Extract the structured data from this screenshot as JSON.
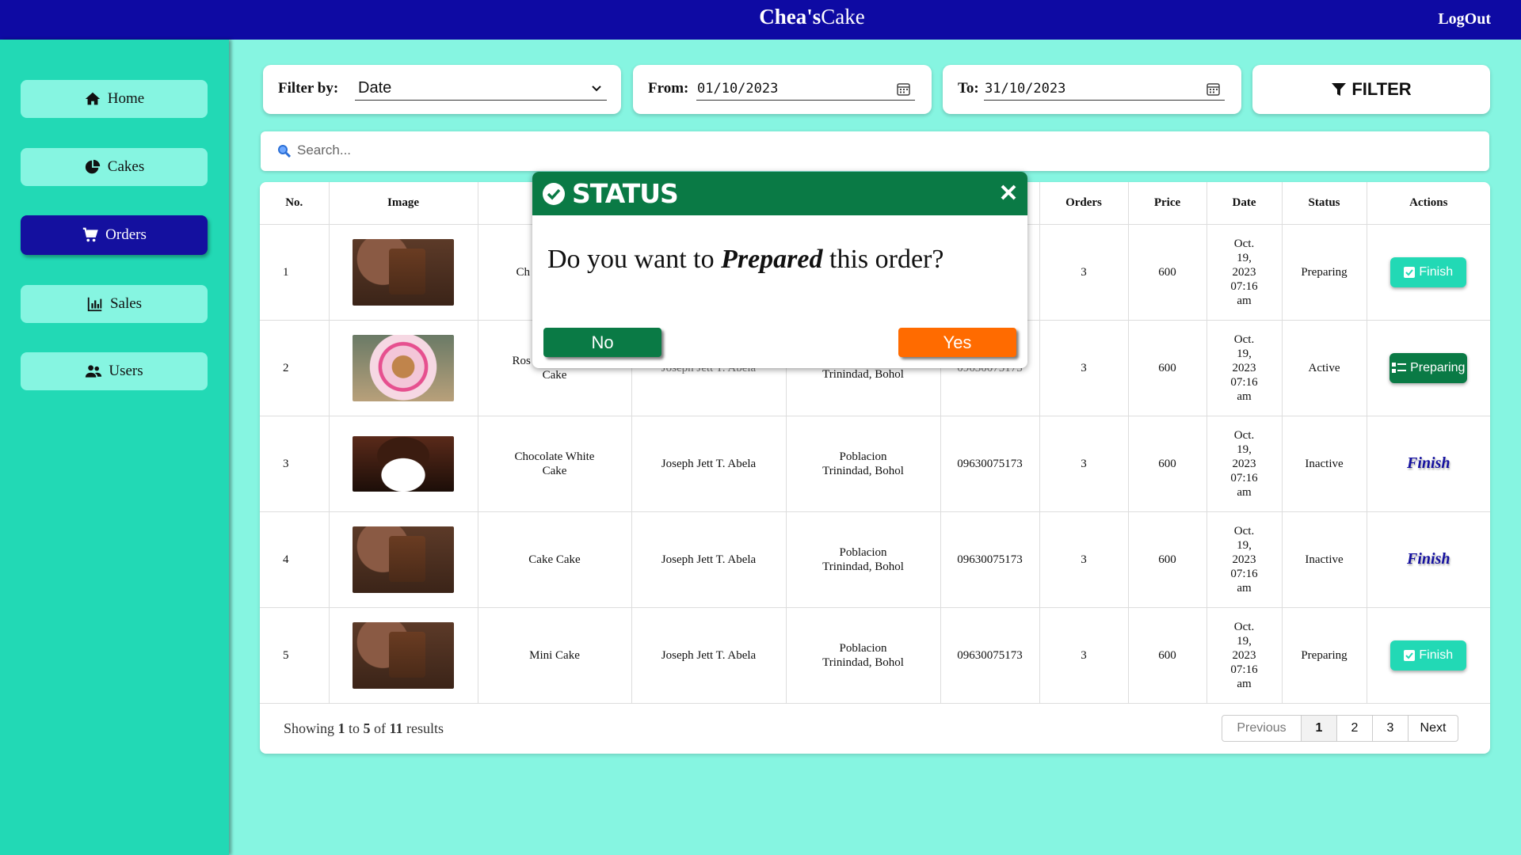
{
  "header": {
    "brand_bold": "Chea's",
    "brand_rest": "Cake",
    "logout": "LogOut"
  },
  "sidebar": {
    "items": [
      {
        "label": "Home",
        "icon": "home-icon"
      },
      {
        "label": "Cakes",
        "icon": "pie-chart-icon"
      },
      {
        "label": "Orders",
        "icon": "cart-icon",
        "active": true
      },
      {
        "label": "Sales",
        "icon": "bar-chart-icon"
      },
      {
        "label": "Users",
        "icon": "users-icon"
      }
    ]
  },
  "filter": {
    "filter_by_label": "Filter by:",
    "filter_by_value": "Date",
    "from_label": "From:",
    "from_value": "01/10/2023",
    "to_label": "To:",
    "to_value": "31/10/2023",
    "button_label": "FILTER"
  },
  "search": {
    "placeholder": "Search..."
  },
  "table": {
    "headers": {
      "no": "No.",
      "image": "Image",
      "orders": "Orders",
      "price": "Price",
      "date": "Date",
      "status": "Status",
      "actions": "Actions"
    },
    "rows": [
      {
        "no": "1",
        "name_partial": "Ch",
        "orders_partial": "3",
        "orders": "3",
        "price": "600",
        "date": [
          "Oct.",
          "19,",
          "2023",
          "07:16",
          "am"
        ],
        "status": "Preparing",
        "action": "Finish"
      },
      {
        "no": "2",
        "name_line1": "Ros",
        "name_line2": "Cake",
        "customer_partial": "Joseph Jett T. Abela",
        "address_partial": "Trinindad, Bohol",
        "phone_partial": "09630075173",
        "orders": "3",
        "price": "600",
        "date": [
          "Oct.",
          "19,",
          "2023",
          "07:16",
          "am"
        ],
        "status": "Active",
        "action": "Preparing"
      },
      {
        "no": "3",
        "name_line1": "Chocolate White",
        "name_line2": "Cake",
        "customer": "Joseph Jett T. Abela",
        "address_line1": "Poblacion",
        "address_line2": "Trinindad, Bohol",
        "phone": "09630075173",
        "orders": "3",
        "price": "600",
        "date": [
          "Oct.",
          "19,",
          "2023",
          "07:16",
          "am"
        ],
        "status": "Inactive",
        "action": "Finish"
      },
      {
        "no": "4",
        "name_line1": "Cake Cake",
        "customer": "Joseph Jett T. Abela",
        "address_line1": "Poblacion",
        "address_line2": "Trinindad, Bohol",
        "phone": "09630075173",
        "orders": "3",
        "price": "600",
        "date": [
          "Oct.",
          "19,",
          "2023",
          "07:16",
          "am"
        ],
        "status": "Inactive",
        "action": "Finish"
      },
      {
        "no": "5",
        "name_line1": "Mini Cake",
        "customer": "Joseph Jett T. Abela",
        "address_line1": "Poblacion",
        "address_line2": "Trinindad, Bohol",
        "phone": "09630075173",
        "orders": "3",
        "price": "600",
        "date": [
          "Oct.",
          "19,",
          "2023",
          "07:16",
          "am"
        ],
        "status": "Preparing",
        "action": "Finish"
      }
    ]
  },
  "pagination": {
    "showing_prefix": "Showing",
    "from": "1",
    "to_word": "to",
    "to": "5",
    "of_word": "of",
    "total": "11",
    "suffix": "results",
    "previous": "Previous",
    "pages": [
      "1",
      "2",
      "3"
    ],
    "next": "Next",
    "current": "1"
  },
  "modal": {
    "title": "STATUS",
    "message_prefix": "Do you want to",
    "message_emphasis": "Prepared",
    "message_suffix": "this order?",
    "no_label": "No",
    "yes_label": "Yes"
  },
  "colors": {
    "header": "#0e0aa3",
    "sidebar": "#22d9b5",
    "page": "#86f5e1",
    "modal_header": "#0a7a45",
    "yes_button": "#ff6b00"
  }
}
